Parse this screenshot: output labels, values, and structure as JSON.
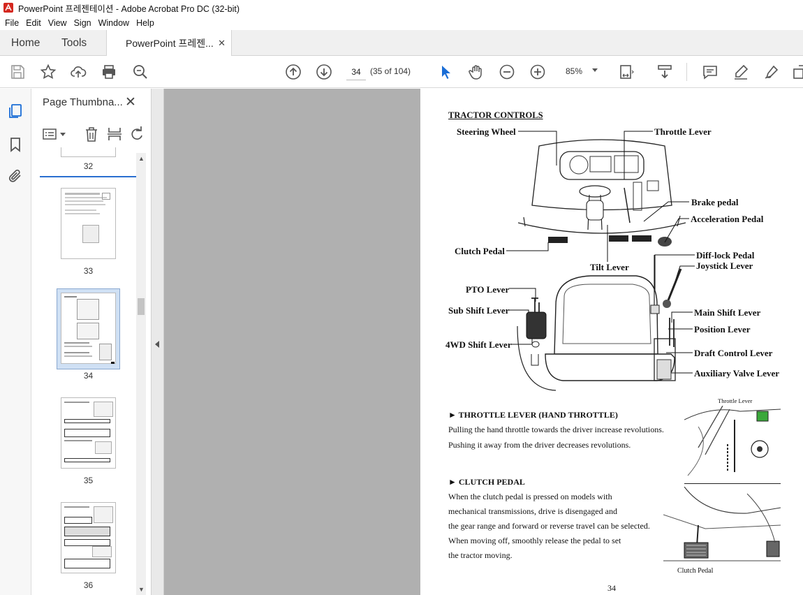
{
  "window": {
    "title": "PowerPoint 프레젠테이션 - Adobe Acrobat Pro DC (32-bit)"
  },
  "menu": [
    "File",
    "Edit",
    "View",
    "Sign",
    "Window",
    "Help"
  ],
  "tabs": {
    "home": "Home",
    "tools": "Tools",
    "document": "PowerPoint 프레젠..."
  },
  "toolbar": {
    "page_current": "34",
    "page_count": "(35 of 104)",
    "zoom": "85%"
  },
  "thumbnails_panel": {
    "title": "Page Thumbna...",
    "pages": [
      {
        "label": "32"
      },
      {
        "label": "33"
      },
      {
        "label": "34"
      },
      {
        "label": "35"
      },
      {
        "label": "36"
      }
    ]
  },
  "document_page": {
    "heading": "TRACTOR CONTROLS",
    "labels": {
      "steering_wheel": "Steering Wheel",
      "throttle_lever": "Throttle Lever",
      "brake_pedal": "Brake pedal",
      "acceleration_pedal": "Acceleration Pedal",
      "clutch_pedal": "Clutch Pedal",
      "tilt_lever": "Tilt Lever",
      "diff_lock_pedal": "Diff-lock Pedal",
      "joystick_lever": "Joystick Lever",
      "pto_lever": "PTO Lever",
      "sub_shift_lever": "Sub Shift Lever",
      "main_shift_lever": "Main Shift Lever",
      "position_lever": "Position Lever",
      "four_wd_shift_lever": "4WD Shift Lever",
      "draft_control_lever": "Draft Control Lever",
      "auxiliary_valve_lever": "Auxiliary Valve Lever"
    },
    "throttle_section": {
      "heading": "► THROTTLE LEVER (HAND THROTTLE)",
      "lines": [
        "Pulling the hand throttle towards the driver increase revolutions.",
        "Pushing it away from the driver decreases revolutions."
      ],
      "image_caption": "Throttle Lever"
    },
    "clutch_section": {
      "heading": "► CLUTCH PEDAL",
      "lines": [
        "When the clutch pedal is pressed on models with",
        "mechanical transmissions, drive is disengaged and",
        "the gear range and forward or reverse travel can be selected.",
        "When moving off, smoothly release the pedal to set",
        "the tractor moving."
      ],
      "image_caption": "Clutch Pedal"
    },
    "page_number": "34"
  }
}
